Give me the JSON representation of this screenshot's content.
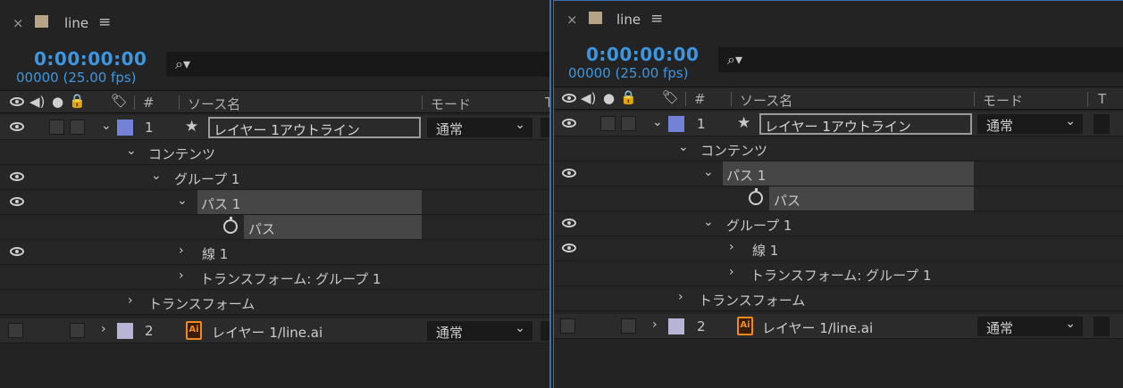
{
  "left": {
    "comp_name": "line",
    "timecode": "0:00:00:00",
    "fps": "00000 (25.00 fps)",
    "search_icon": "⌕▾",
    "columns": {
      "hash": "#",
      "source": "ソース名",
      "mode": "モード",
      "t": "T"
    },
    "rows": [
      {
        "kind": "layer",
        "num": "1",
        "name": "レイヤー 1アウトライン",
        "mode": "通常",
        "label_color": "#7382d6"
      },
      {
        "kind": "prop",
        "name": "コンテンツ"
      },
      {
        "kind": "prop",
        "name": "グループ 1"
      },
      {
        "kind": "prop",
        "name": "パス 1"
      },
      {
        "kind": "prop",
        "name": "パス"
      },
      {
        "kind": "prop",
        "name": "線 1"
      },
      {
        "kind": "prop",
        "name": "トランスフォーム: グループ 1"
      },
      {
        "kind": "prop",
        "name": "トランスフォーム"
      },
      {
        "kind": "layer",
        "num": "2",
        "name": "レイヤー 1/line.ai",
        "mode": "通常",
        "label_color": "#b7b4d6"
      }
    ]
  },
  "right": {
    "comp_name": "line",
    "timecode": "0:00:00:00",
    "fps": "00000 (25.00 fps)",
    "search_icon": "⌕▾",
    "columns": {
      "hash": "#",
      "source": "ソース名",
      "mode": "モード",
      "t": "T"
    },
    "rows": [
      {
        "kind": "layer",
        "num": "1",
        "name": "レイヤー 1アウトライン",
        "mode": "通常",
        "label_color": "#7382d6"
      },
      {
        "kind": "prop",
        "name": "コンテンツ"
      },
      {
        "kind": "prop",
        "name": "パス 1"
      },
      {
        "kind": "prop",
        "name": "パス"
      },
      {
        "kind": "prop",
        "name": "グループ 1"
      },
      {
        "kind": "prop",
        "name": "線 1"
      },
      {
        "kind": "prop",
        "name": "トランスフォーム: グループ 1"
      },
      {
        "kind": "prop",
        "name": "トランスフォーム"
      },
      {
        "kind": "layer",
        "num": "2",
        "name": "レイヤー 1/line.ai",
        "mode": "通常",
        "label_color": "#b7b4d6"
      }
    ]
  },
  "icons": {
    "close": "×",
    "menu": "≡",
    "star": "★",
    "chev_down": "⌄",
    "chev_right": "›",
    "ai_letters": "Ai"
  },
  "colors": {
    "accent": "#3d97e0",
    "panel_border": "#3a6fb0",
    "ai_orange": "#f08a1e"
  }
}
